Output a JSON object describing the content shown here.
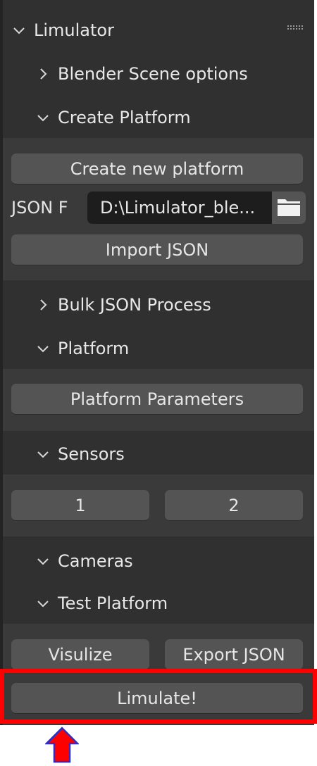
{
  "panel": {
    "title": "Limulator",
    "grip_icon": "drag-grip-icon"
  },
  "sections": {
    "blender_scene_options": "Blender Scene options",
    "create_platform": "Create Platform",
    "bulk_json_process": "Bulk JSON Process",
    "platform": "Platform",
    "sensors": "Sensors",
    "cameras": "Cameras",
    "test_platform": "Test Platform"
  },
  "create_platform": {
    "create_new_platform_label": "Create new platform",
    "json_field_label": "JSON F",
    "json_field_value": "D:\\Limulator_ble...",
    "folder_icon": "folder-icon",
    "import_json_label": "Import JSON"
  },
  "platform": {
    "platform_parameters_label": "Platform Parameters"
  },
  "sensors": {
    "buttons": [
      "1",
      "2"
    ]
  },
  "test_platform": {
    "visualize_label": "Visulize",
    "export_json_label": "Export JSON"
  },
  "limulate": {
    "label": "Limulate!"
  },
  "colors": {
    "panel_bg": "#303030",
    "subpanel_bg": "#3a3a3a",
    "button_bg": "#545454",
    "field_bg": "#1d1d1d",
    "highlight": "#ff0000"
  }
}
